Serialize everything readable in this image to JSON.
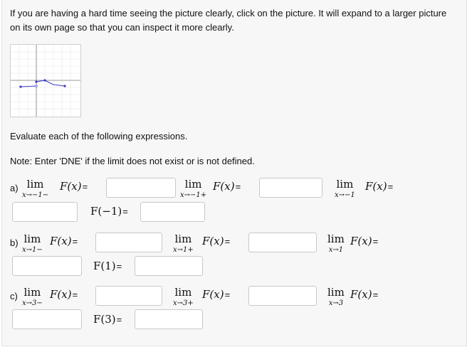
{
  "intro": "If you are having a hard time seeing the picture clearly, click on the picture. It will expand to a larger picture on its own page so that you can inspect it more clearly.",
  "instruction": "Evaluate each of the following expressions.",
  "note": "Note: Enter 'DNE' if the limit does not exist or is not defined.",
  "lim_word": "lim",
  "function_label": "F(x)",
  "equals": "=",
  "parts": [
    {
      "letter": "a)",
      "left_sub": "x→−1−",
      "right_sub": "x→−1+",
      "two_sided_sub": "x→−1",
      "value_label": "F(−1)"
    },
    {
      "letter": "b)",
      "left_sub": "x→1−",
      "right_sub": "x→1+",
      "two_sided_sub": "x→1",
      "value_label": "F(1)"
    },
    {
      "letter": "c)",
      "left_sub": "x→3−",
      "right_sub": "x→3+",
      "two_sided_sub": "x→3",
      "value_label": "F(3)"
    }
  ],
  "answers": {
    "a_left": "",
    "a_right": "",
    "a_two": "",
    "a_value": "",
    "b_left": "",
    "b_right": "",
    "b_two": "",
    "b_value": "",
    "c_left": "",
    "c_right": "",
    "c_two": "",
    "c_value": ""
  },
  "graph_color": "#3a3acc"
}
